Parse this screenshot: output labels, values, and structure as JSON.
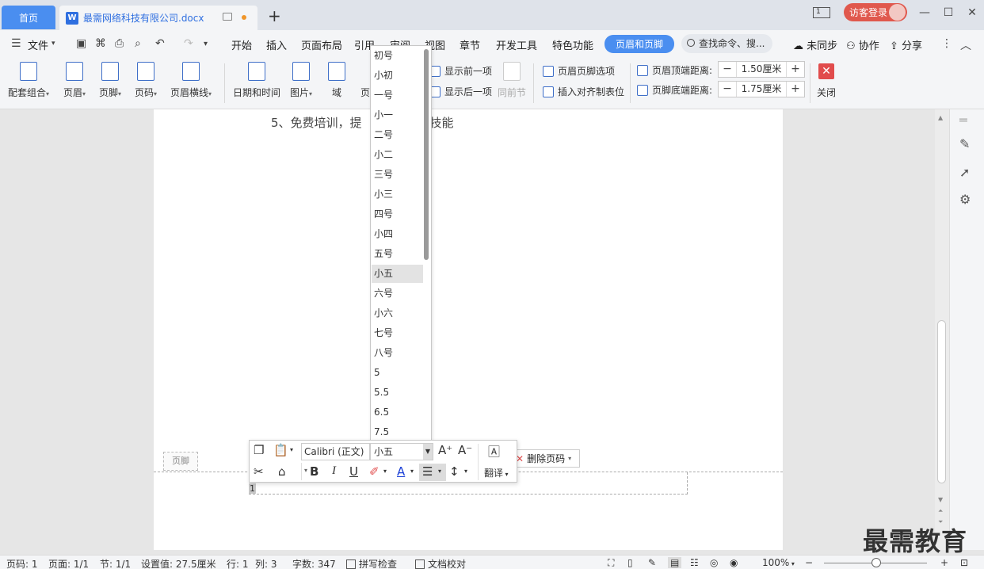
{
  "titlebar": {
    "home_tab": "首页",
    "doc_tab": "最需网络科技有限公司.docx",
    "doc_icon": "W",
    "new_tab": "+",
    "tile_label": "1",
    "login": "访客登录",
    "minimize": "—",
    "maximize": "☐",
    "close": "✕"
  },
  "menubar": {
    "file": "文件",
    "items": [
      "开始",
      "插入",
      "页面布局",
      "引用",
      "审阅",
      "视图",
      "章节",
      "开发工具",
      "特色功能"
    ],
    "active": "页眉和页脚",
    "search": "查找命令、搜...",
    "sync": "未同步",
    "collab": "协作",
    "share": "分享"
  },
  "ribbon": {
    "combo": "配套组合",
    "header": "页眉",
    "footer": "页脚",
    "page_number": "页码",
    "header_line": "页眉横线",
    "datetime": "日期和时间",
    "picture": "图片",
    "field": "域",
    "page_partial": "页",
    "show_prev": "显示前一项",
    "show_next": "显示后一项",
    "same_prev": "同前节",
    "hf_options": "页眉页脚选项",
    "insert_tab": "插入对齐制表位",
    "header_top_dist": "页眉顶端距离:",
    "header_top_value": "1.50厘米",
    "footer_bottom_dist": "页脚底端距离:",
    "footer_bottom_value": "1.75厘米",
    "close": "关闭"
  },
  "document": {
    "line5": "5、免费培训，提",
    "line5_tail": "技能",
    "footer_tag": "页脚",
    "page_num": "1",
    "delete_page_number": "删除页码"
  },
  "font_sizes": {
    "items": [
      "初号",
      "小初",
      "一号",
      "小一",
      "二号",
      "小二",
      "三号",
      "小三",
      "四号",
      "小四",
      "五号",
      "小五",
      "六号",
      "小六",
      "七号",
      "八号",
      "5",
      "5.5",
      "6.5",
      "7.5"
    ],
    "selected": "小五"
  },
  "mini_toolbar": {
    "font": "Calibri (正文)",
    "size": "小五",
    "translate": "翻译",
    "bold": "B",
    "italic": "I",
    "underline": "U"
  },
  "statusbar": {
    "page_code": "页码: 1",
    "page": "页面: 1/1",
    "section": "节: 1/1",
    "setting": "设置值: 27.5厘米",
    "row": "行: 1",
    "col": "列: 3",
    "word_count": "字数: 347",
    "spell_check": "拼写检查",
    "doc_proof": "文档校对",
    "zoom": "100%"
  },
  "watermark": "最需教育",
  "colors": {
    "accent": "#4a8ef0",
    "login": "#e0584d",
    "close": "#e14c4c"
  }
}
